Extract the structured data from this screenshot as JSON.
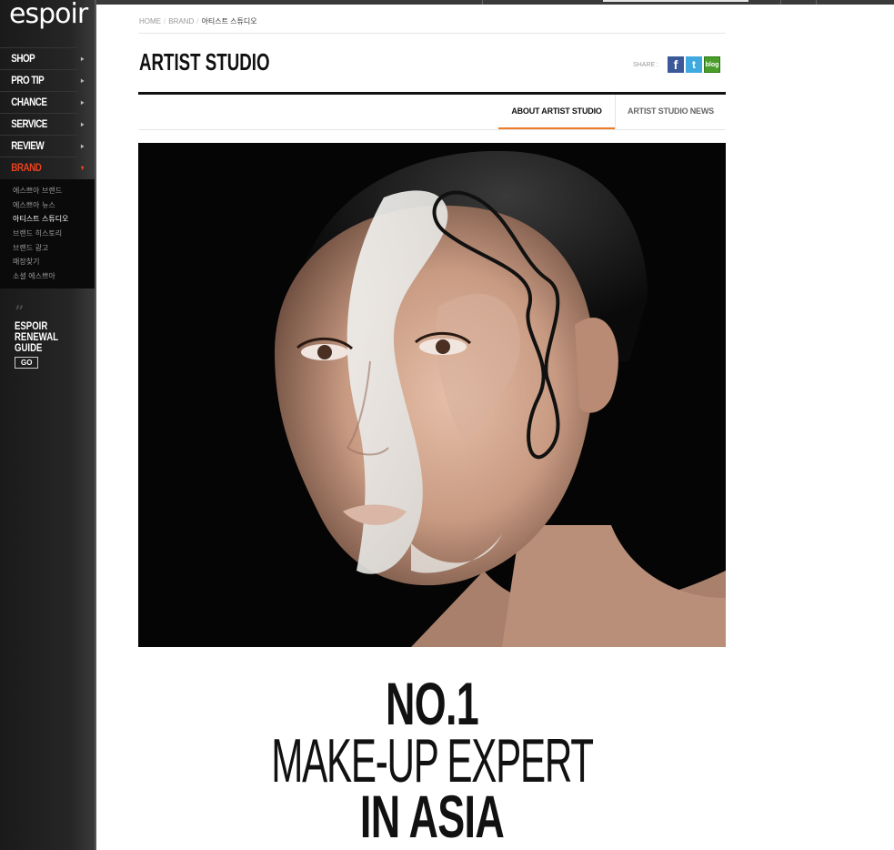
{
  "brand": {
    "logo": "espoir"
  },
  "menu": [
    {
      "label": "SHOP",
      "active": false
    },
    {
      "label": "PRO TIP",
      "active": false
    },
    {
      "label": "CHANCE",
      "active": false
    },
    {
      "label": "SERVICE",
      "active": false
    },
    {
      "label": "REVIEW",
      "active": false
    },
    {
      "label": "BRAND",
      "active": true
    }
  ],
  "submenu": [
    {
      "label": "에스쁘아 브랜드"
    },
    {
      "label": "에스쁘아 뉴스"
    },
    {
      "label": "아티스트 스튜디오",
      "current": true
    },
    {
      "label": "브랜드 히스토리"
    },
    {
      "label": "브랜드 광고"
    },
    {
      "label": "매장찾기"
    },
    {
      "label": "소셜 에스쁘아"
    }
  ],
  "renewal": {
    "line1": "ESPOIR",
    "line2": "RENEWAL",
    "line3": "GUIDE",
    "go": "GO"
  },
  "breadcrumb": {
    "home": "HOME",
    "brand": "BRAND",
    "current": "아티스트 스튜디오"
  },
  "page": {
    "title": "ARTIST STUDIO"
  },
  "share": {
    "label": "SHARE :",
    "facebook": "f",
    "twitter": "t",
    "blog": "blog"
  },
  "tabs": [
    {
      "label": "ABOUT ARTIST STUDIO",
      "active": true
    },
    {
      "label": "ARTIST STUDIO NEWS",
      "active": false
    }
  ],
  "headline": {
    "line1": "NO.1",
    "line2": "MAKE-UP EXPERT",
    "line3": "IN ASIA"
  },
  "colors": {
    "accent": "#e8421e",
    "tab_underline": "#f07a28",
    "facebook": "#3b5998",
    "twitter": "#3fa9e0",
    "blog": "#4a9d2a"
  }
}
